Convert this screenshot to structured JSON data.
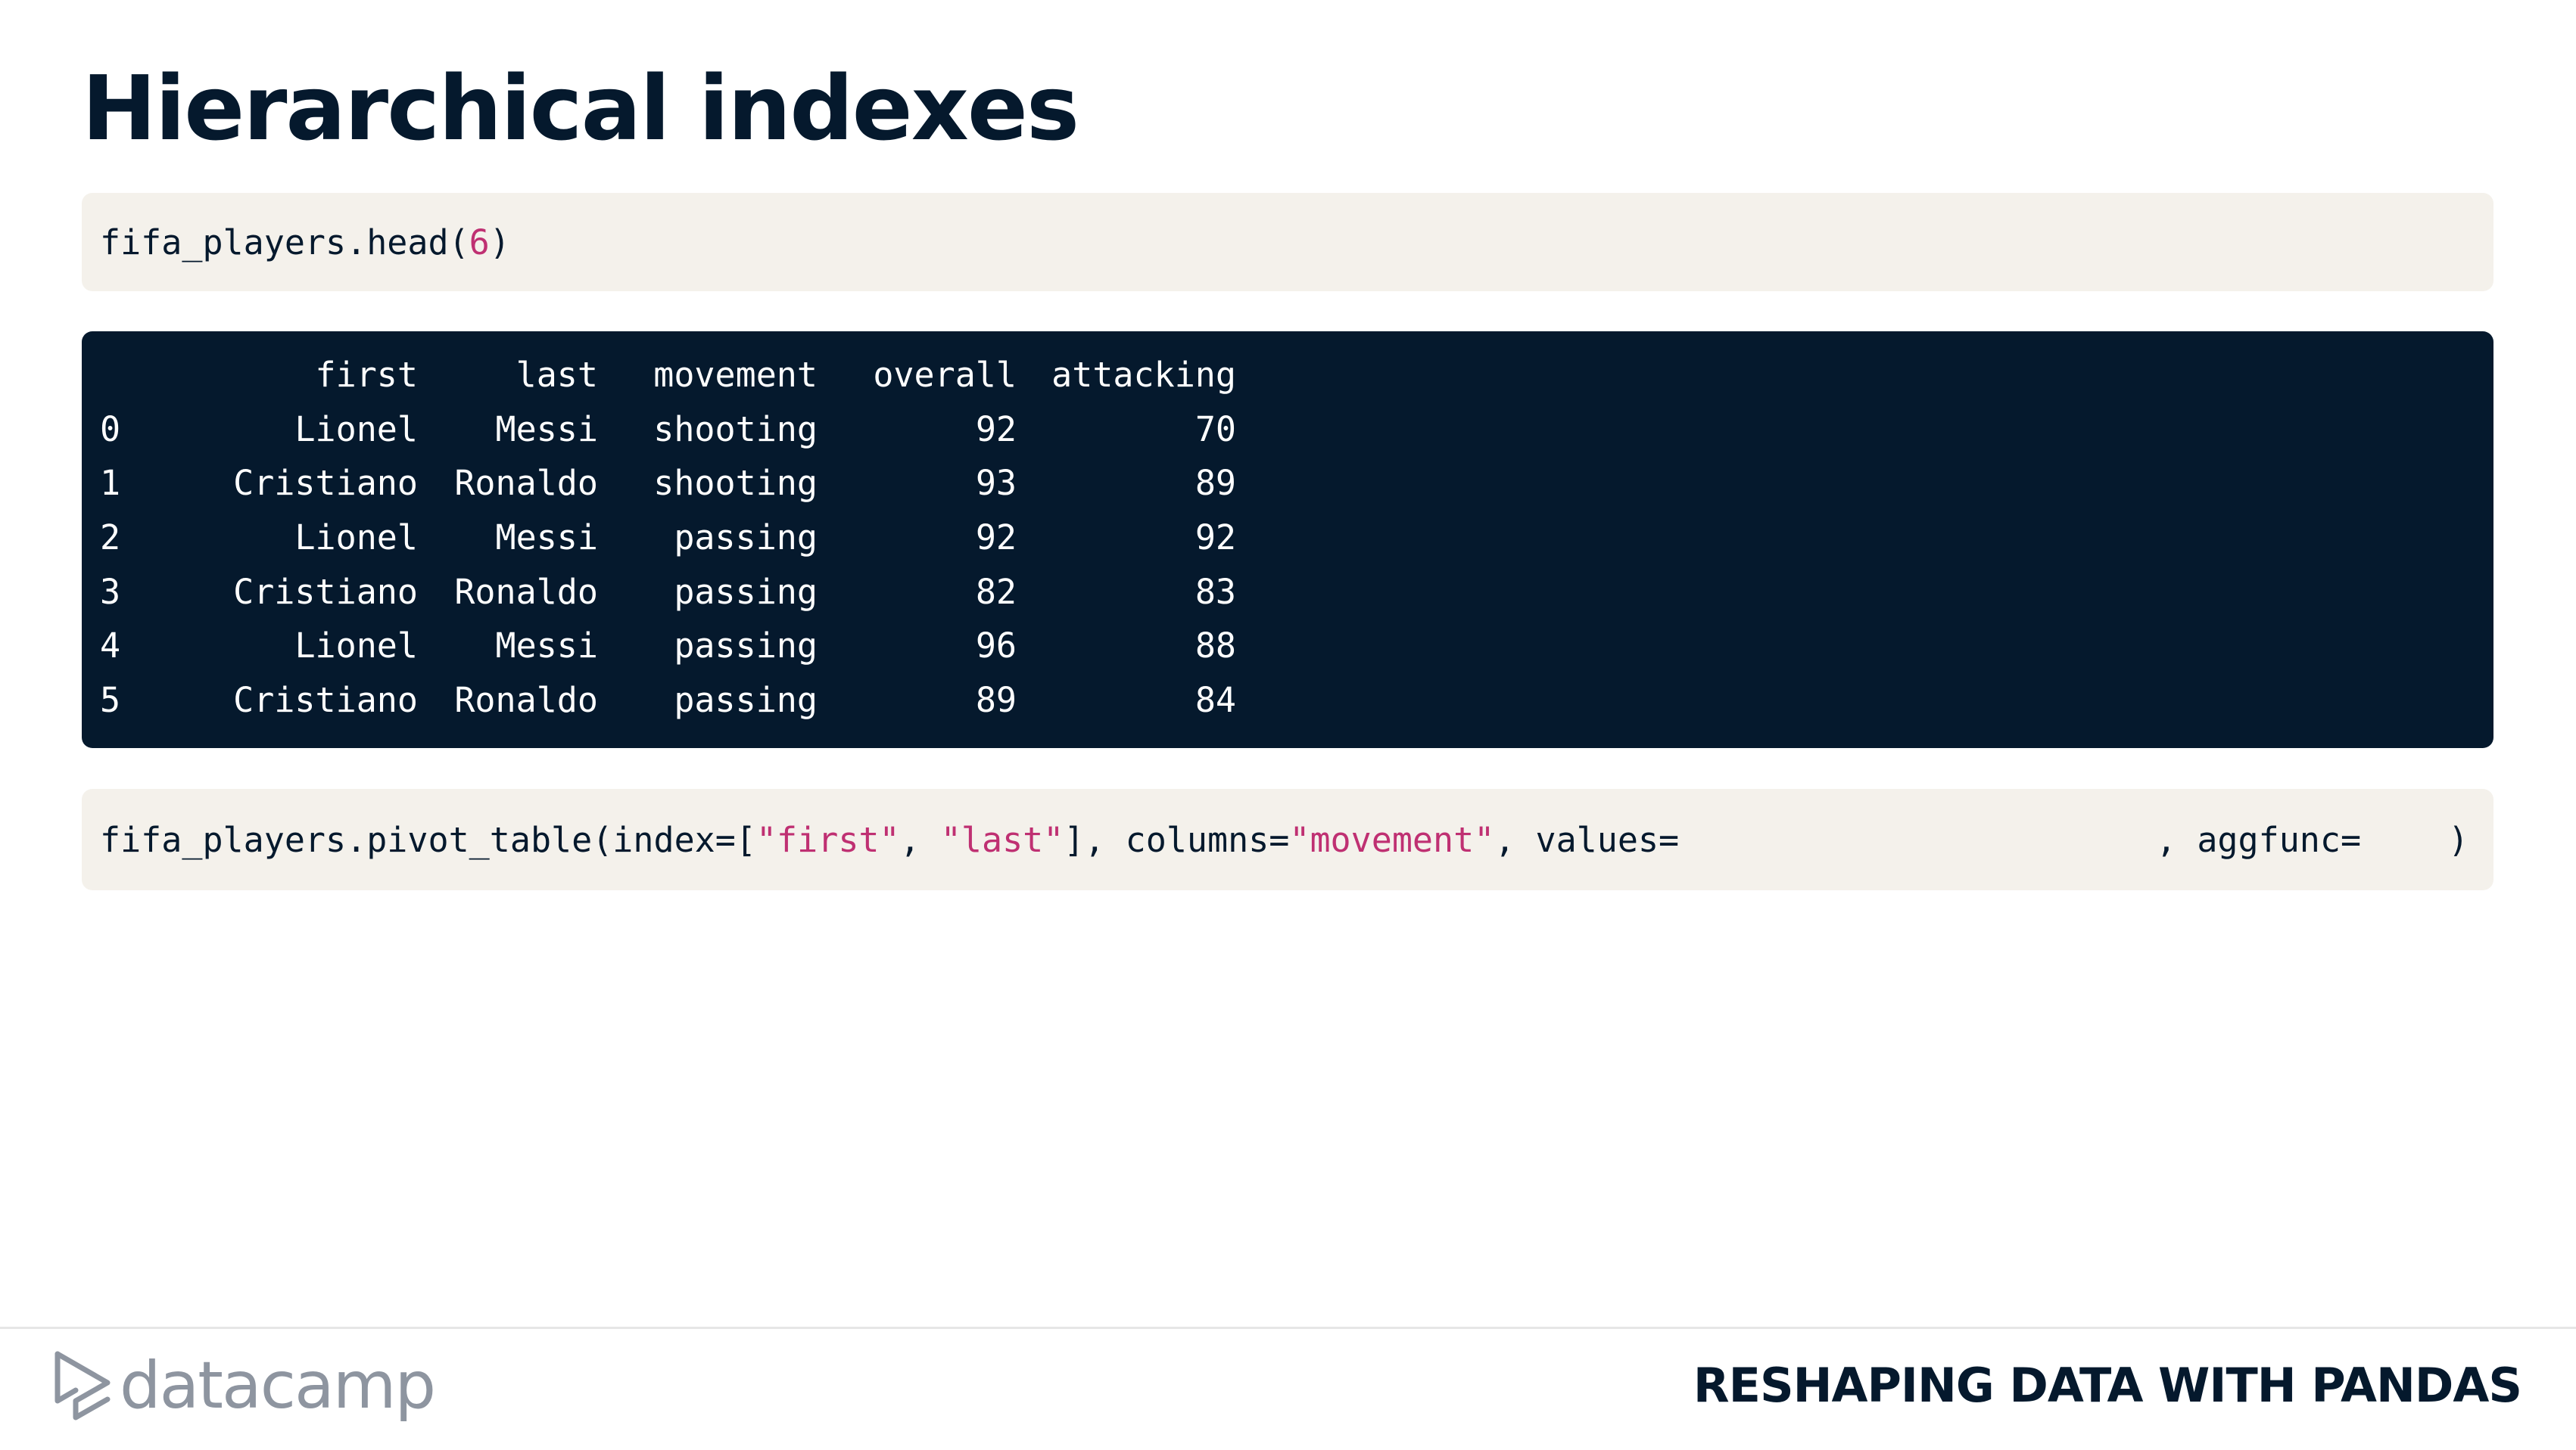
{
  "slide": {
    "title": "Hierarchical indexes"
  },
  "code1": {
    "prefix": "fifa_players.head(",
    "arg": "6",
    "suffix": ")"
  },
  "output_table": {
    "columns": [
      "",
      "first",
      "last",
      "movement",
      "overall",
      "attacking"
    ],
    "rows": [
      [
        "0",
        "Lionel",
        "Messi",
        "shooting",
        "92",
        "70"
      ],
      [
        "1",
        "Cristiano",
        "Ronaldo",
        "shooting",
        "93",
        "89"
      ],
      [
        "2",
        "Lionel",
        "Messi",
        "passing",
        "92",
        "92"
      ],
      [
        "3",
        "Cristiano",
        "Ronaldo",
        "passing",
        "82",
        "83"
      ],
      [
        "4",
        "Lionel",
        "Messi",
        "passing",
        "96",
        "88"
      ],
      [
        "5",
        "Cristiano",
        "Ronaldo",
        "passing",
        "89",
        "84"
      ]
    ]
  },
  "code2": {
    "p1": "fifa_players.pivot_table(index=[",
    "s1": "\"first\"",
    "p2": ", ",
    "s2": "\"last\"",
    "p3": "], columns=",
    "s3": "\"movement\"",
    "p4": ", values=",
    "p5": ", aggfunc=",
    "p6": ")"
  },
  "footer": {
    "logo_text": "datacamp",
    "course_title": "RESHAPING DATA WITH PANDAS"
  },
  "colors": {
    "navy": "#05192d",
    "code_bg": "#f4f1eb",
    "string": "#bf3072",
    "logo_gray": "#8e95a0"
  }
}
